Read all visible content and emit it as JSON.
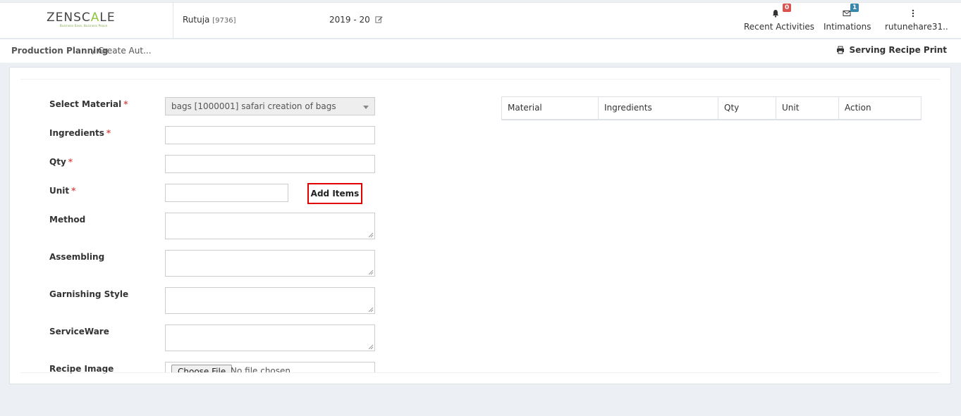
{
  "app": {
    "logo_text_1": "ZENSC",
    "logo_text_2": "A",
    "logo_text_3": "LE",
    "logo_tagline": "Business Ease, Business Peace"
  },
  "header": {
    "user_name": "Rutuja",
    "user_id": "[9736]",
    "financial_year": "2019 - 20",
    "nav": {
      "activities": {
        "label": "Recent Activities",
        "badge": "0",
        "icon": "bell-icon"
      },
      "intimations": {
        "label": "Intimations",
        "badge": "1",
        "icon": "envelope-icon"
      },
      "user": {
        "label": "rutunehare31..",
        "icon": "kebab-menu-icon"
      }
    }
  },
  "breadcrumb": {
    "item1": "Production Planning",
    "item2": "/ Create Aut...",
    "print_label": "Serving Recipe Print"
  },
  "form": {
    "select_material_label": "Select Material",
    "select_material_value": "bags [1000001] safari creation of bags",
    "ingredients_label": "Ingredients",
    "ingredients_value": "",
    "qty_label": "Qty",
    "qty_value": "",
    "unit_label": "Unit",
    "unit_value": "",
    "add_items_label": "Add Items",
    "method_label": "Method",
    "assembling_label": "Assembling",
    "garnishing_label": "Garnishing Style",
    "serviceware_label": "ServiceWare",
    "recipe_image_label": "Recipe Image",
    "choose_file_label": "Choose File",
    "no_file_label": "No file chosen",
    "required_mark": "*"
  },
  "table": {
    "columns": [
      "Material",
      "Ingredients",
      "Qty",
      "Unit",
      "Action"
    ]
  },
  "colors": {
    "accent_green": "#8cc63f",
    "required_red": "#d9534f",
    "highlight_red": "#e00000",
    "badge_red": "#d9534f",
    "badge_blue": "#3a87ad"
  }
}
